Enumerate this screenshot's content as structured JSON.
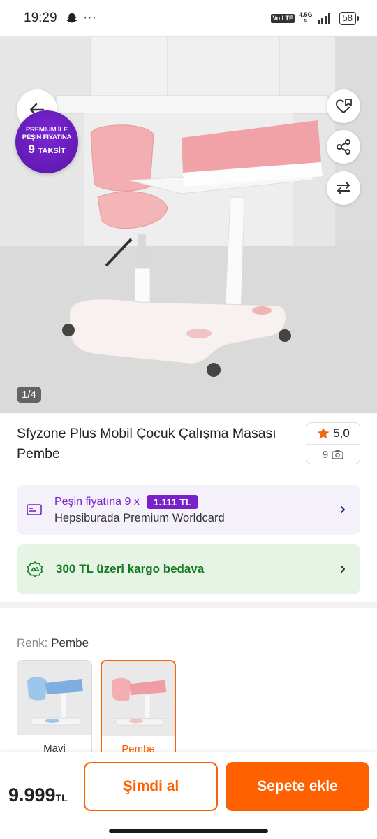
{
  "status_bar": {
    "time": "19:29",
    "notification_icons": [
      "snapchat-icon",
      "more-dots-icon"
    ],
    "dots": "···",
    "volte": "Vo LTE",
    "network": "4.5G",
    "battery": "58"
  },
  "gallery": {
    "promo_badge": {
      "line1": "PREMIUM İLE",
      "line2": "PEŞİN FİYATINA",
      "line3_number": "9",
      "line3_word": "TAKSİT"
    },
    "counter": "1/4",
    "icons": [
      "back-arrow-icon",
      "heart-plus-icon",
      "share-icon",
      "compare-icon"
    ]
  },
  "product": {
    "title": "Sfyzone Plus Mobil Çocuk Çalışma Masası Pembe",
    "rating": "5,0",
    "photo_review_count": "9"
  },
  "premium_offer": {
    "prefix": "Peşin fiyatına 9 x",
    "installment_price": "1.111 TL",
    "card_name": "Hepsiburada Premium Worldcard"
  },
  "cargo_offer": {
    "text": "300 TL üzeri kargo bedava"
  },
  "color_selector": {
    "label_key": "Renk:",
    "label_value": "Pembe",
    "options": [
      {
        "name": "Mavi",
        "selected": false
      },
      {
        "name": "Pembe",
        "selected": true
      }
    ]
  },
  "bottom_bar": {
    "price": "9.999",
    "currency": "TL",
    "buy_now_label": "Şimdi al",
    "add_to_cart_label": "Sepete ekle"
  },
  "colors": {
    "accent_orange": "#ff6000",
    "premium_purple": "#7a22c9",
    "cargo_green": "#167a22"
  }
}
